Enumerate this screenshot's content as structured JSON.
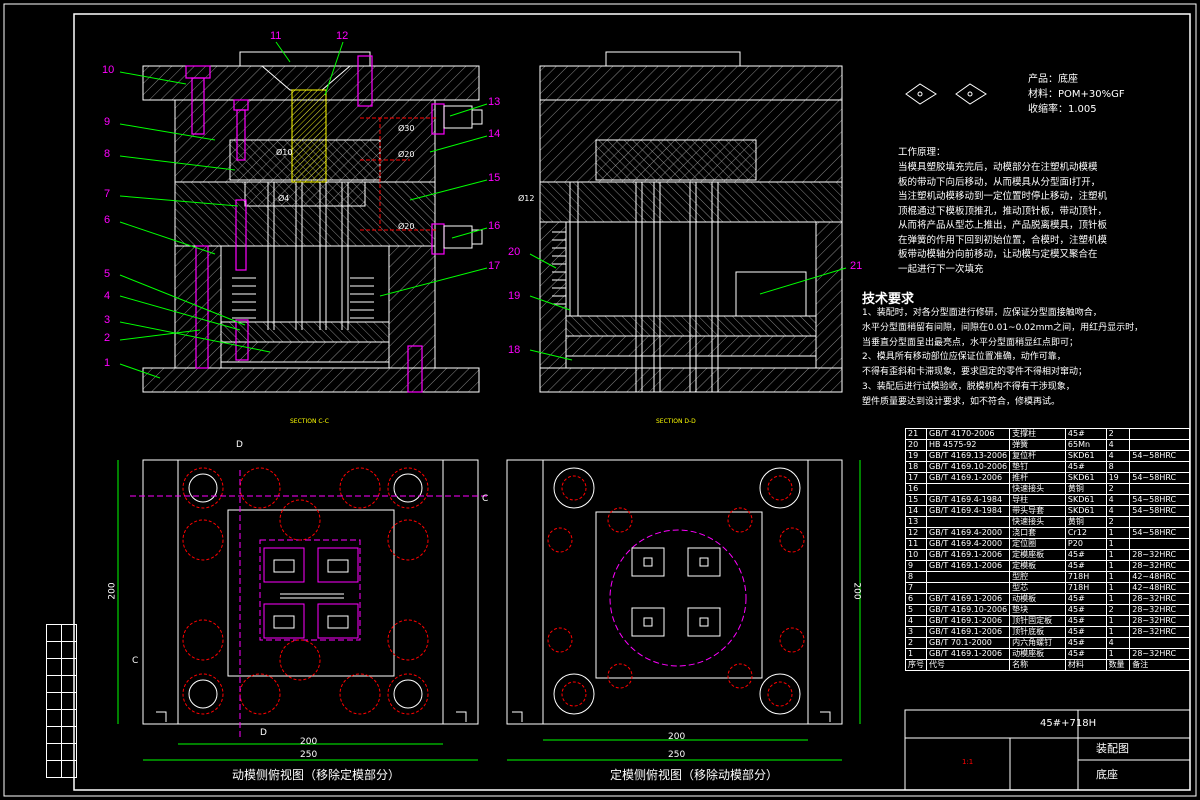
{
  "part_numbers": [
    "1",
    "2",
    "3",
    "4",
    "5",
    "6",
    "7",
    "8",
    "9",
    "10",
    "11",
    "12",
    "13",
    "14",
    "15",
    "16",
    "17",
    "18",
    "19",
    "20",
    "21"
  ],
  "dims": {
    "d10": "Ø10",
    "d4": "Ø4",
    "d30": "Ø30",
    "d20": "Ø20",
    "d20b": "Ø20",
    "d12": "Ø12",
    "w200a": "200",
    "w250a": "250",
    "h200a": "200",
    "w200b": "200",
    "w250b": "250",
    "h200b": "200"
  },
  "sections": {
    "cc": "SECTION C-C",
    "dd": "SECTION D-D",
    "c_mark": "C",
    "d_mark": "D"
  },
  "product": {
    "name": "产品：底座",
    "material": "材料：POM+30%GF",
    "shrink": "收缩率：1.005"
  },
  "principle": {
    "title": "工作原理：",
    "lines": [
      "当模具塑胶填充完后，动模部分在注塑机动模模",
      "板的带动下向后移动，从而模具从分型面Ⅰ打开，",
      "当注塑机动模移动到一定位置时停止移动，注塑机",
      "顶棍通过下模板顶推孔，推动顶针板，带动顶针，",
      "从而将产品从型芯上推出，产品脱离模具，顶针板",
      "在弹簧的作用下回到初始位置，合模时，注塑机模",
      "板带动模轴分向前移动，让动模与定模又聚合在",
      "一起进行下一次填充"
    ]
  },
  "tech": {
    "title": "技术要求",
    "lines": [
      "1、装配时，对各分型面进行修研，应保证分型面接触吻合，",
      "水平分型面稍留有间隙，间隙在0.01~0.02mm之间，用红丹显示时，",
      "当垂直分型面呈出最亮点，水平分型面稍显红点即可；",
      "2、模具所有移动部位应保证位置准确，动作可靠，",
      "不得有歪斜和卡滞现象，要求固定的零件不得相对窜动；",
      "3、装配后进行试模验收，脱模机构不得有干涉现象，",
      "塑件质量要达到设计要求，如不符合，修模再试。"
    ]
  },
  "bom": [
    [
      "21",
      "GB/T 4170-2006",
      "支撑柱",
      "45#",
      "2",
      ""
    ],
    [
      "20",
      "HB 4575-92",
      "弹簧",
      "65Mn",
      "4",
      ""
    ],
    [
      "19",
      "GB/T 4169.13-2006",
      "复位杆",
      "SKD61",
      "4",
      "54~58HRC"
    ],
    [
      "18",
      "GB/T 4169.10-2006",
      "垫钉",
      "45#",
      "8",
      ""
    ],
    [
      "17",
      "GB/T 4169.1-2006",
      "推杆",
      "SKD61",
      "19",
      "54~58HRC"
    ],
    [
      "16",
      "",
      "快速接头",
      "黄铜",
      "2",
      ""
    ],
    [
      "15",
      "GB/T 4169.4-1984",
      "导柱",
      "SKD61",
      "4",
      "54~58HRC"
    ],
    [
      "14",
      "GB/T 4169.4-1984",
      "带头导套",
      "SKD61",
      "4",
      "54~58HRC"
    ],
    [
      "13",
      "",
      "快速接头",
      "黄铜",
      "2",
      ""
    ],
    [
      "12",
      "GB/T 4169.4-2000",
      "浇口套",
      "Cr12",
      "1",
      "54~58HRC"
    ],
    [
      "11",
      "GB/T 4169.4-2000",
      "定位圈",
      "P20",
      "1",
      ""
    ],
    [
      "10",
      "GB/T 4169.1-2006",
      "定模座板",
      "45#",
      "1",
      "28~32HRC"
    ],
    [
      "9",
      "GB/T 4169.1-2006",
      "定模板",
      "45#",
      "1",
      "28~32HRC"
    ],
    [
      "8",
      "",
      "型腔",
      "718H",
      "1",
      "42~48HRC"
    ],
    [
      "7",
      "",
      "型芯",
      "718H",
      "1",
      "42~48HRC"
    ],
    [
      "6",
      "GB/T 4169.1-2006",
      "动模板",
      "45#",
      "1",
      "28~32HRC"
    ],
    [
      "5",
      "GB/T 4169.10-2006",
      "垫块",
      "45#",
      "2",
      "28~32HRC"
    ],
    [
      "4",
      "GB/T 4169.1-2006",
      "顶针固定板",
      "45#",
      "1",
      "28~32HRC"
    ],
    [
      "3",
      "GB/T 4169.1-2006",
      "顶针底板",
      "45#",
      "1",
      "28~32HRC"
    ],
    [
      "2",
      "GB/T 70.1-2000",
      "内六角螺钉",
      "45#",
      "4",
      ""
    ],
    [
      "1",
      "GB/T 4169.1-2006",
      "动模座板",
      "45#",
      "1",
      "28~32HRC"
    ]
  ],
  "bom_header": [
    "序号",
    "代号",
    "名称",
    "材料",
    "数量",
    "备注"
  ],
  "title_block": {
    "material_code": "45#+718H",
    "drawing_name": "装配图",
    "part_name": "底座",
    "sheet": "1:1"
  },
  "views": {
    "moving": "动模侧俯视图（移除定模部分）",
    "fixed": "定模侧俯视图（移除动模部分）"
  },
  "colors": {
    "white": "#ffffff",
    "green": "#00ff00",
    "magenta": "#ff00ff",
    "yellow": "#ffff00",
    "red": "#ff0000",
    "cyan": "#00ffff"
  }
}
